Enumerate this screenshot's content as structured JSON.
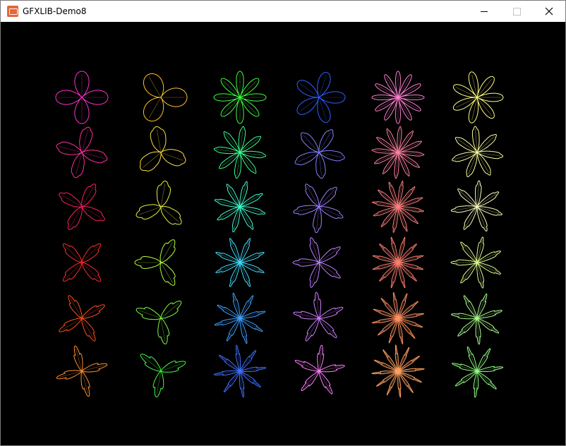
{
  "window": {
    "title": "GFXLIB-Demo8",
    "icon": "gfx-app-icon",
    "controls": {
      "minimize": "minimize-icon",
      "maximize": "maximize-icon",
      "close": "close-icon"
    }
  },
  "canvas": {
    "background": "#000000",
    "grid": {
      "rows": 6,
      "cols": 6
    },
    "columns": [
      {
        "petals": 4,
        "colors": [
          "#ff30d0",
          "#ff30a0",
          "#ff2060",
          "#ff2a2a",
          "#ff5020",
          "#ff9030"
        ]
      },
      {
        "petals": 3,
        "colors": [
          "#ffc030",
          "#ffe040",
          "#e8f040",
          "#b8ff40",
          "#80ff40",
          "#40ff40"
        ]
      },
      {
        "petals": 8,
        "colors": [
          "#40ff40",
          "#40ff90",
          "#40ffd0",
          "#40e0ff",
          "#40a0ff",
          "#4070ff"
        ]
      },
      {
        "petals": 5,
        "colors": [
          "#3060ff",
          "#8080ff",
          "#a080ff",
          "#c080ff",
          "#d080ff",
          "#ff80ff"
        ]
      },
      {
        "petals": 12,
        "colors": [
          "#ff80d0",
          "#ff80a0",
          "#ff8080",
          "#ff8070",
          "#ff9060",
          "#ffa060"
        ]
      },
      {
        "petals": 7,
        "colors": [
          "#ffff80",
          "#ffffa0",
          "#ffffc0",
          "#e0ff90",
          "#b0ff90",
          "#90ff80"
        ]
      }
    ]
  }
}
